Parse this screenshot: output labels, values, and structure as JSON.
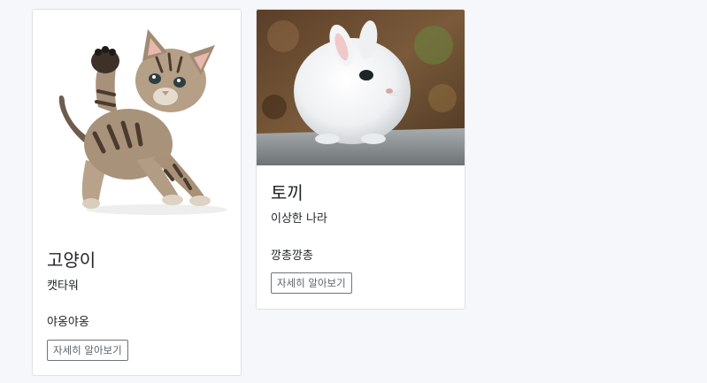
{
  "cards": [
    {
      "image_subject": "kitten",
      "title": "고양이",
      "subtitle": "캣타워",
      "text": "야옹야옹",
      "button_label": "자세히 알아보기"
    },
    {
      "image_subject": "rabbit",
      "title": "토끼",
      "subtitle": "이상한 나라",
      "text": "깡총깡총",
      "button_label": "자세히 알아보기"
    }
  ],
  "colors": {
    "page_background": "#f6f7fa",
    "card_border": "#dfe1e4",
    "button_border": "#6c757d",
    "button_text": "#5c636a"
  }
}
